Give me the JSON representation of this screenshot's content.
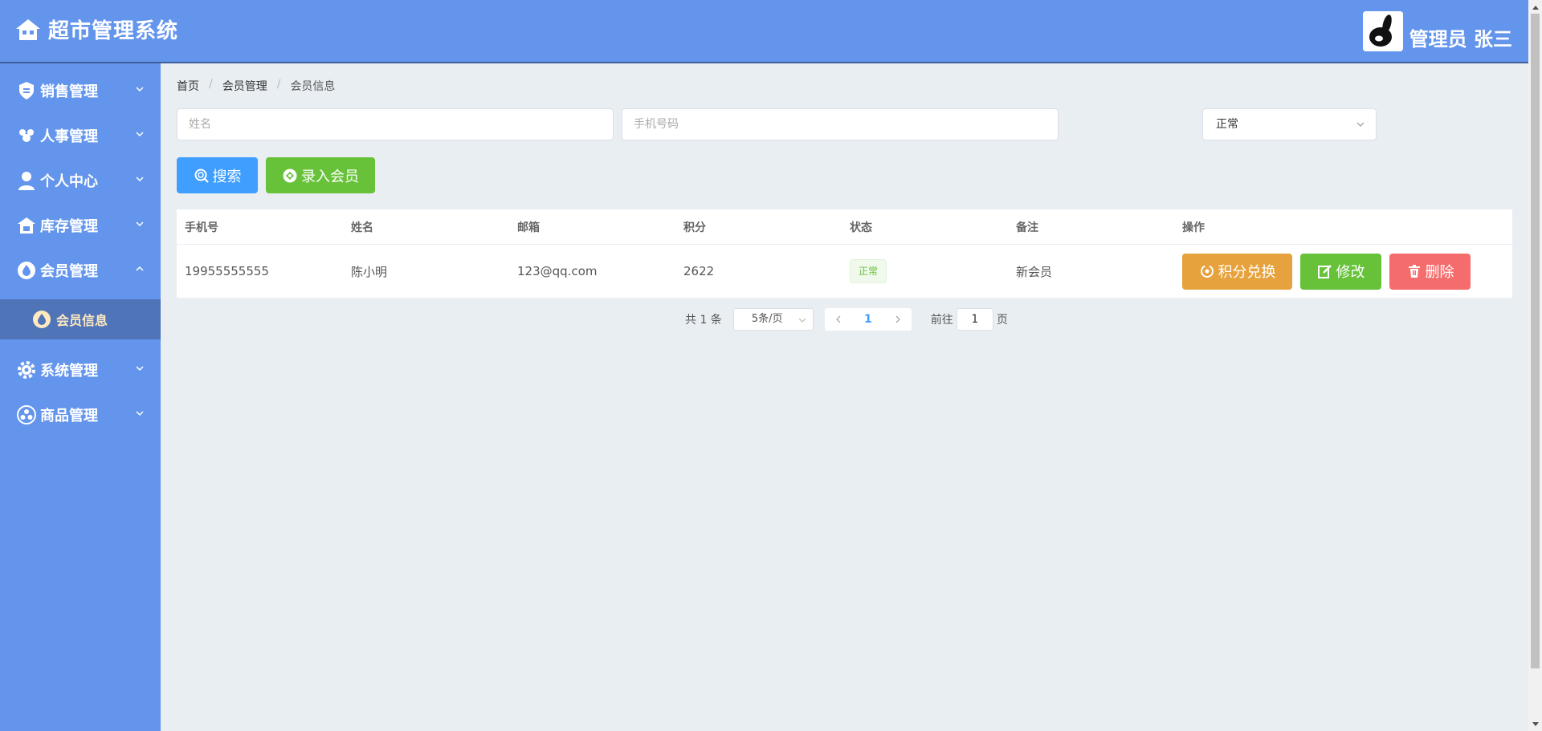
{
  "app": {
    "title": "超市管理系统"
  },
  "user": {
    "name": "管理员 张三"
  },
  "sidebar": {
    "items": [
      {
        "label": "销售管理",
        "icon": "badge-icon"
      },
      {
        "label": "人事管理",
        "icon": "people-icon"
      },
      {
        "label": "个人中心",
        "icon": "user-icon"
      },
      {
        "label": "库存管理",
        "icon": "warehouse-icon"
      },
      {
        "label": "会员管理",
        "icon": "drop-icon",
        "expanded": true
      },
      {
        "label": "系统管理",
        "icon": "gear-icon"
      },
      {
        "label": "商品管理",
        "icon": "goods-icon"
      }
    ],
    "active_sub": {
      "label": "会员信息"
    }
  },
  "breadcrumb": [
    "首页",
    "会员管理",
    "会员信息"
  ],
  "filters": {
    "name_placeholder": "姓名",
    "phone_placeholder": "手机号码",
    "status_value": "正常"
  },
  "buttons": {
    "search": "搜索",
    "add_member": "录入会员"
  },
  "table": {
    "columns": [
      "手机号",
      "姓名",
      "邮箱",
      "积分",
      "状态",
      "备注",
      "操作"
    ],
    "rows": [
      {
        "phone": "19955555555",
        "name": "陈小明",
        "email": "123@qq.com",
        "points": "2622",
        "status": "正常",
        "remark": "新会员"
      }
    ],
    "actions": {
      "exchange": "积分兑换",
      "edit": "修改",
      "delete": "删除"
    }
  },
  "pagination": {
    "total": "共 1 条",
    "page_size": "5条/页",
    "current_page": "1",
    "goto_label": "前往",
    "goto_value": "1",
    "page_suffix": "页"
  },
  "colors": {
    "primary": "#6495ed",
    "blue": "#409eff",
    "green": "#67c23a",
    "orange": "#e6a23c",
    "red": "#f56c6c"
  }
}
